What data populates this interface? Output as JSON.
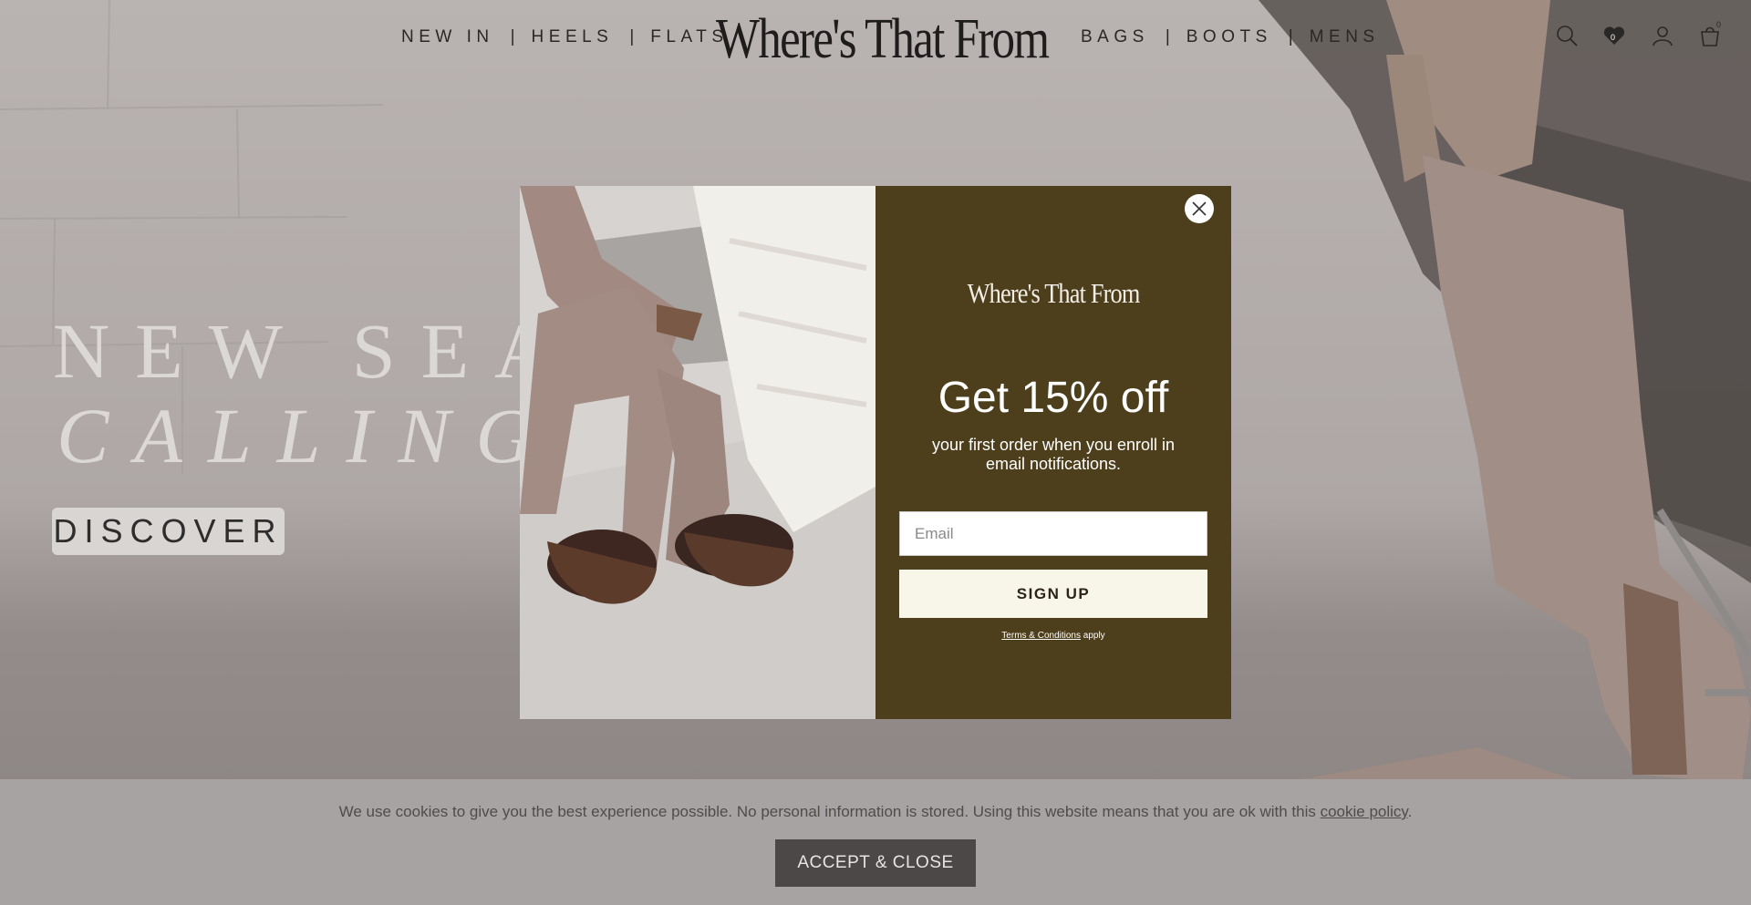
{
  "header": {
    "nav_left": [
      "NEW IN",
      "HEELS",
      "FLATS"
    ],
    "nav_right": [
      "BAGS",
      "BOOTS",
      "MENS"
    ],
    "logo": "Where's That From",
    "icons": [
      "search-icon",
      "wishlist-icon",
      "account-icon",
      "cart-icon"
    ],
    "wishlist_count": "0",
    "cart_count": "0"
  },
  "hero": {
    "title_line1": "NEW SEA",
    "title_line2": "CALLING",
    "cta_label": "DISCOVER"
  },
  "modal": {
    "close_icon": "close-icon",
    "logo": "Where's That From",
    "headline": "Get 15% off",
    "subtext": "your first order when you enroll in email notifications.",
    "email_placeholder": "Email",
    "signup_label": "SIGN UP",
    "terms_link": "Terms & Conditions",
    "terms_suffix": " apply",
    "colors": {
      "panel": "#4d3e1c",
      "button": "#f8f5e9"
    }
  },
  "cookie_bar": {
    "text": "We use cookies to give you the best experience possible. No personal information is stored. Using this website means that you are ok with this ",
    "link": "cookie policy",
    "text_end": ".",
    "accept_label": "ACCEPT & CLOSE"
  }
}
